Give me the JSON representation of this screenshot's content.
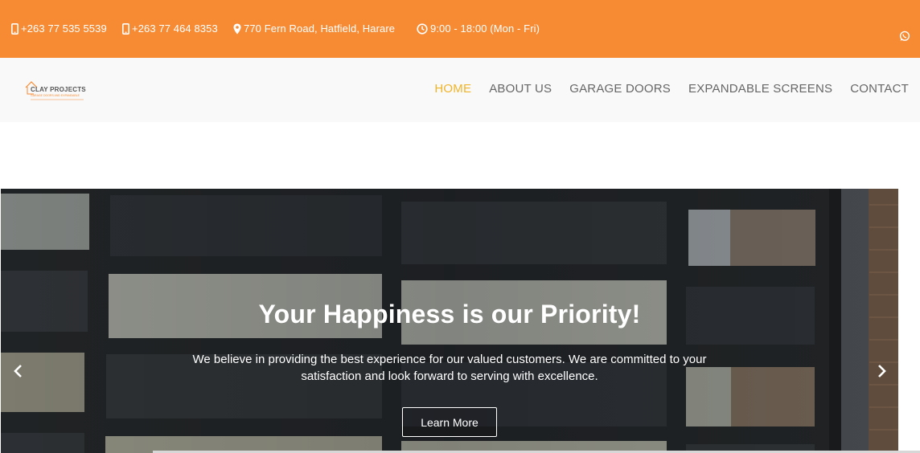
{
  "topbar": {
    "phone1": "+263 77 535 5539",
    "phone2": "+263 77 464 8353",
    "address": "770 Fern Road, Hatfield, Harare",
    "hours": "9:00 - 18:00 (Mon - Fri)",
    "icons": [
      "mobile-phone-icon",
      "mobile-phone-icon",
      "map-marker-icon",
      "clock-icon",
      "whatsapp-icon"
    ]
  },
  "logo": {
    "text": "CLAY PROJECTS",
    "tagline": "GARAGE DOORS AND EXPANDABLE"
  },
  "nav": {
    "items": [
      "HOME",
      "ABOUT US",
      "GARAGE DOORS",
      "EXPANDABLE SCREENS",
      "CONTACT"
    ],
    "active": "HOME"
  },
  "hero": {
    "title": "Your Happiness is our Priority!",
    "text": "We believe in providing the best experience for our valued customers. We are committed to your satisfaction and look forward to serving with excellence.",
    "button": "Learn More"
  },
  "colors": {
    "topbar": "#f68b34",
    "nav_active": "#f0b429",
    "nav_text": "#666666"
  }
}
